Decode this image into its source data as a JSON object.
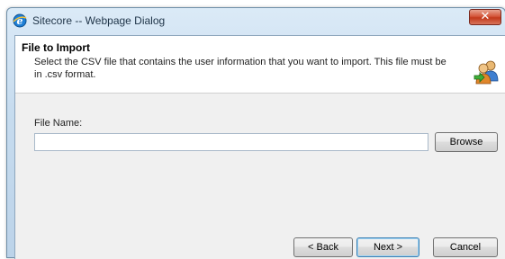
{
  "window": {
    "title": "Sitecore -- Webpage Dialog",
    "close_label": "✕"
  },
  "header": {
    "title": "File to Import",
    "description": "Select the CSV file that contains the user information that you want to import. This file must be in .csv format.",
    "icon": "users-icon"
  },
  "form": {
    "file_label": "File Name:",
    "file_value": "",
    "browse_label": "Browse"
  },
  "footer": {
    "back_label": "< Back",
    "next_label": "Next >",
    "cancel_label": "Cancel"
  },
  "colors": {
    "title_bar": "#c7dcef",
    "close_button": "#c2391b",
    "dialog_background": "#f0f0f0",
    "header_background": "#ffffff"
  }
}
